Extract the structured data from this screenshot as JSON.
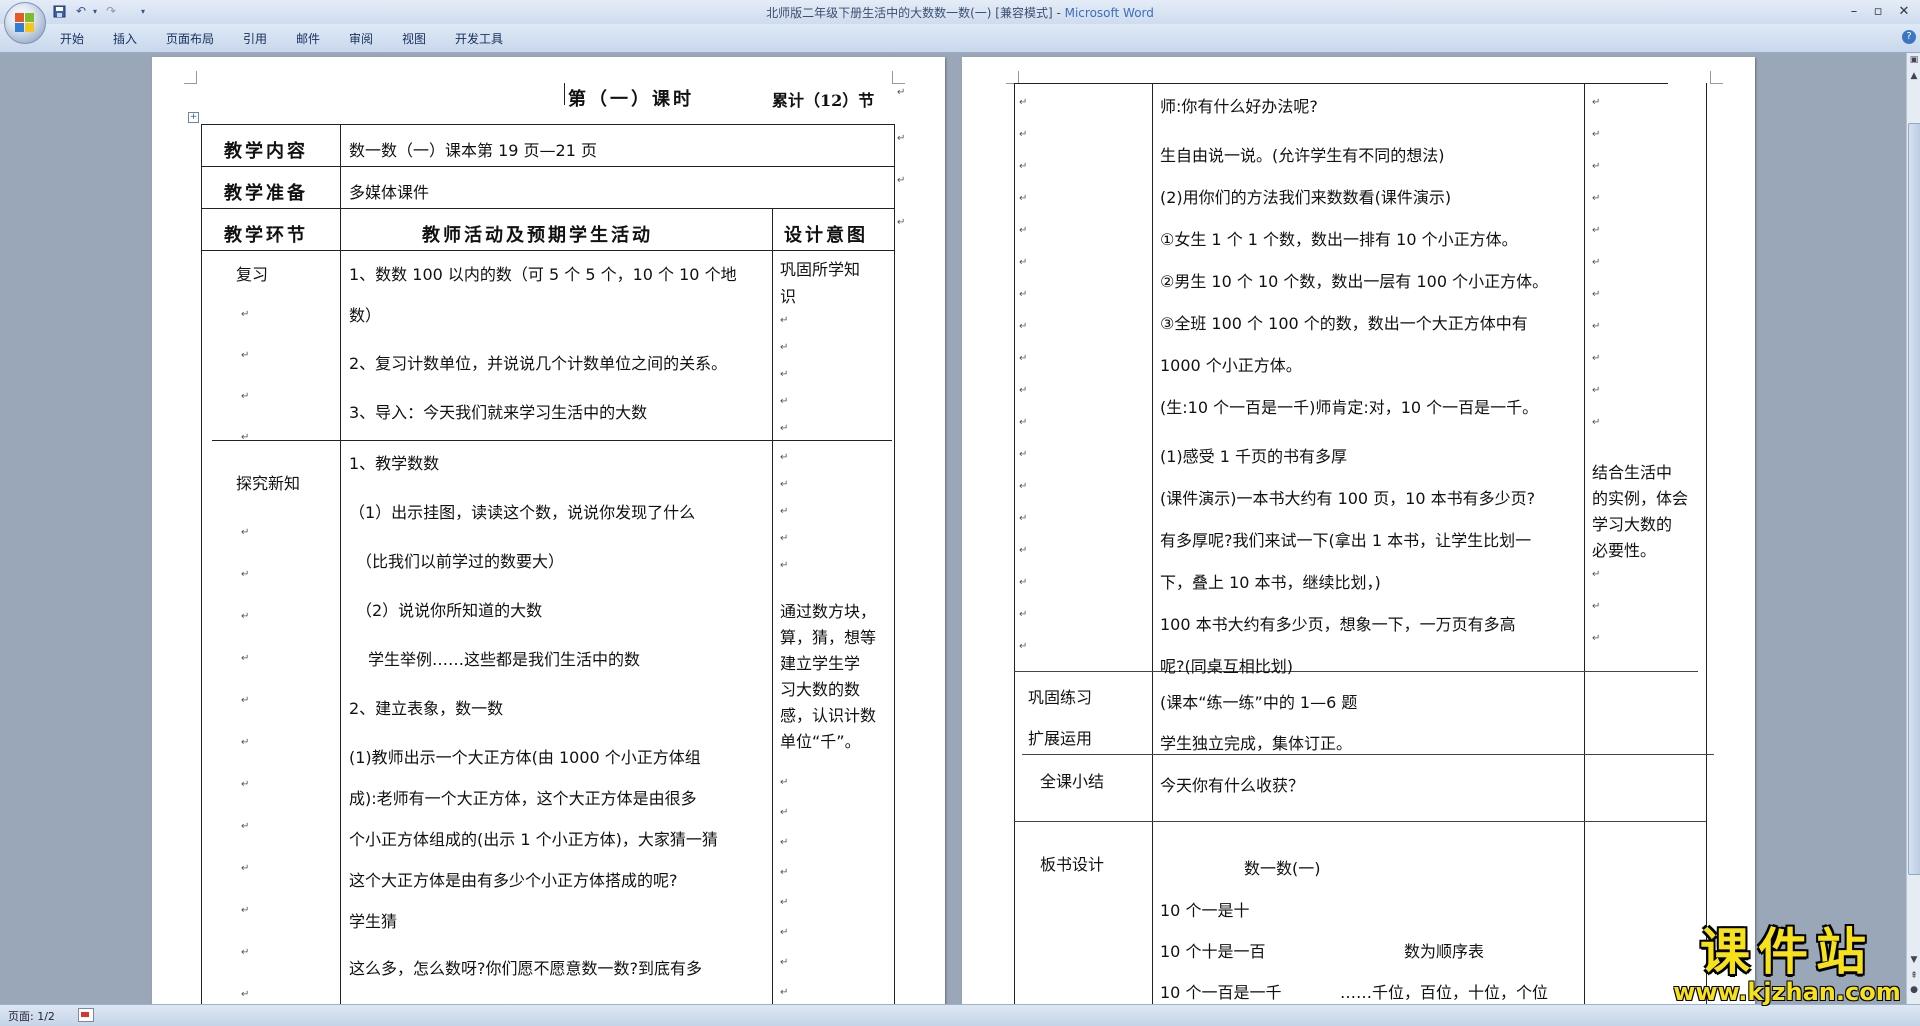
{
  "window": {
    "title_doc": "北师版二年级下册生活中的大数数一数(一) [兼容模式]",
    "title_sep": " - ",
    "title_app": "Microsoft Word"
  },
  "ribbon": {
    "tabs": [
      "开始",
      "插入",
      "页面布局",
      "引用",
      "邮件",
      "审阅",
      "视图",
      "开发工具"
    ]
  },
  "page1": {
    "heading": "第（一）课时",
    "cumulative": "累计（12）节",
    "row_content_label": "教学内容",
    "row_content_value": "数一数（一）课本第 19 页—21 页",
    "row_prep_label": "教学准备",
    "row_prep_value": "多媒体课件",
    "col_stage": "教学环节",
    "col_activity": "教师活动及预期学生活动",
    "col_intent": "设计意图",
    "review_label": "复习",
    "review_lines": [
      "1、数数 100 以内的数（可 5 个 5 个，10 个 10 个地",
      "数）",
      "2、复习计数单位，并说说几个计数单位之间的关系。",
      "3、导入：今天我们就来学习生活中的大数"
    ],
    "review_intent": [
      "巩固所学知",
      "识"
    ],
    "explore_label": "探究新知",
    "explore_lines": [
      "1、教学数数",
      "（1）出示挂图，读读这个数，说说你发现了什么",
      "（比我们以前学过的数要大）",
      "（2）说说你所知道的大数",
      "学生举例……这些都是我们生活中的数",
      "2、建立表象，数一数",
      "(1)教师出示一个大正方体(由 1000 个小正方体组",
      "成):老师有一个大正方体，这个大正方体是由很多",
      "个小正方体组成的(出示 1 个小正方体)，大家猜一猜",
      "这个大正方体是由有多少个小正方体搭成的呢?",
      "学生猜",
      "这么多，怎么数呀?你们愿不愿意数一数?到底有多"
    ],
    "explore_intent": [
      "通过数方块，",
      "算，猜，想等",
      "建立学生学",
      "习大数的数",
      "感，认识计数",
      "单位“千”。"
    ]
  },
  "page2": {
    "top_lines": [
      "师:你有什么好办法呢?",
      "生自由说一说。(允许学生有不同的想法)",
      "(2)用你们的方法我们来数数看(课件演示)",
      "①女生 1 个 1 个数，数出一排有 10 个小正方体。",
      "②男生 10 个 10 个数，数出一层有 100 个小正方体。",
      "③全班 100 个 100 个的数，数出一个大正方体中有",
      "1000 个小正方体。",
      "(生:10 个一百是一千)师肯定:对，10 个一百是一千。",
      "(1)感受 1 千页的书有多厚",
      "(课件演示)一本书大约有 100 页，10 本书有多少页?",
      "有多厚呢?我们来试一下(拿出 1 本书，让学生比划一",
      "下，叠上 10 本书，继续比划，)",
      "100  本书大约有多少页，想象一下，一万页有多高",
      "呢?(同桌互相比划)"
    ],
    "top_intent": [
      "结合生活中",
      "的实例，体会",
      "学习大数的",
      "必要性。"
    ],
    "practice_label_1": "巩固练习",
    "practice_label_2": "扩展运用",
    "practice_lines": [
      "(课本“练一练”中的 1—6 题",
      "学生独立完成，集体订正。"
    ],
    "summary_label": "全课小结",
    "summary_line": "今天你有什么收获？",
    "board_label": "板书设计",
    "board_title": "数一数(一)",
    "board_lines": [
      "10 个一是十",
      "10 个十是一百",
      "10 个一百是一千"
    ],
    "board_right_1": "数为顺序表",
    "board_right_2": "……千位，百位，十位，个位"
  },
  "status": {
    "page": "页面: 1/2"
  },
  "watermark": {
    "text": "课件站",
    "url": "www.kjzhan.com"
  }
}
